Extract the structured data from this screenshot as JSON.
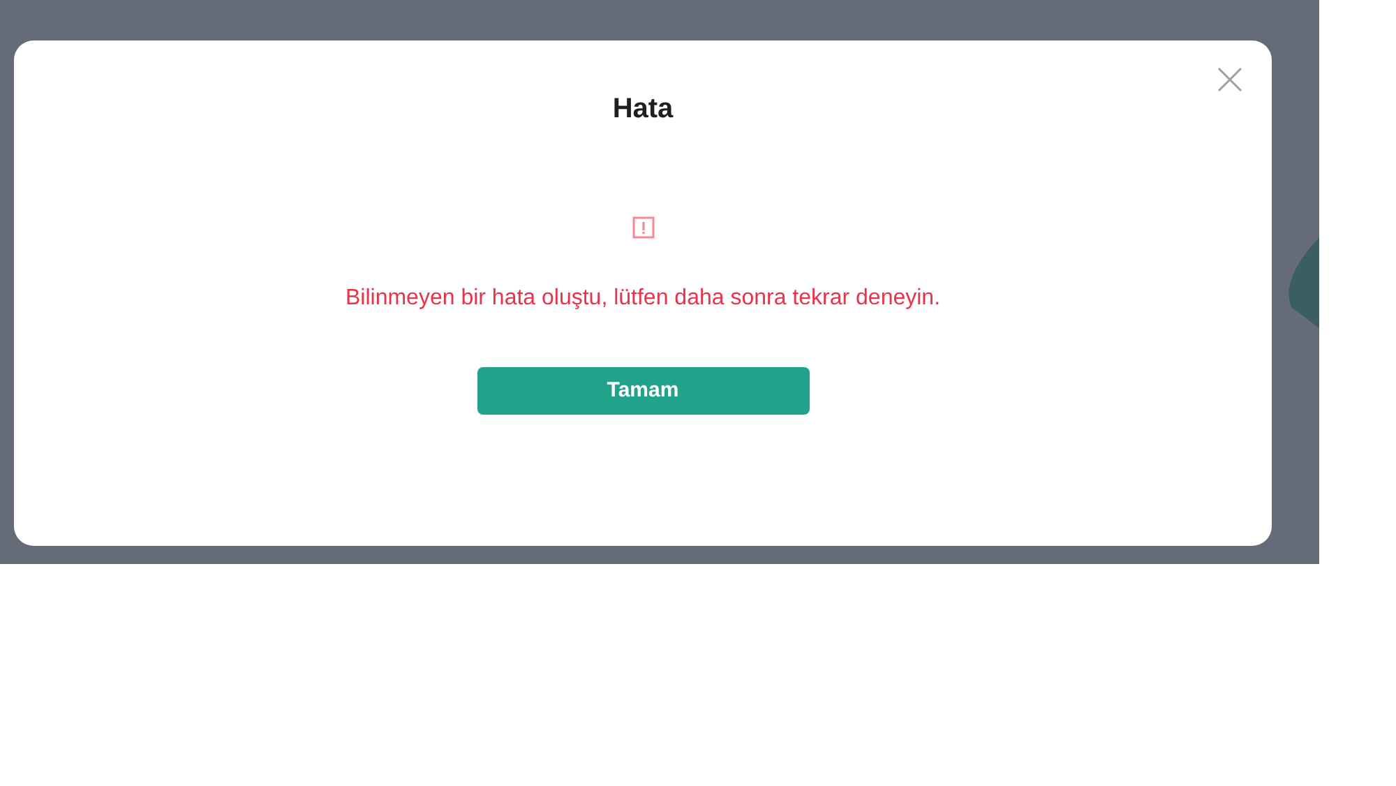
{
  "dialog": {
    "title": "Hata",
    "message": "Bilinmeyen bir hata oluştu, lütfen daha sonra tekrar deneyin.",
    "button": "Tamam"
  }
}
